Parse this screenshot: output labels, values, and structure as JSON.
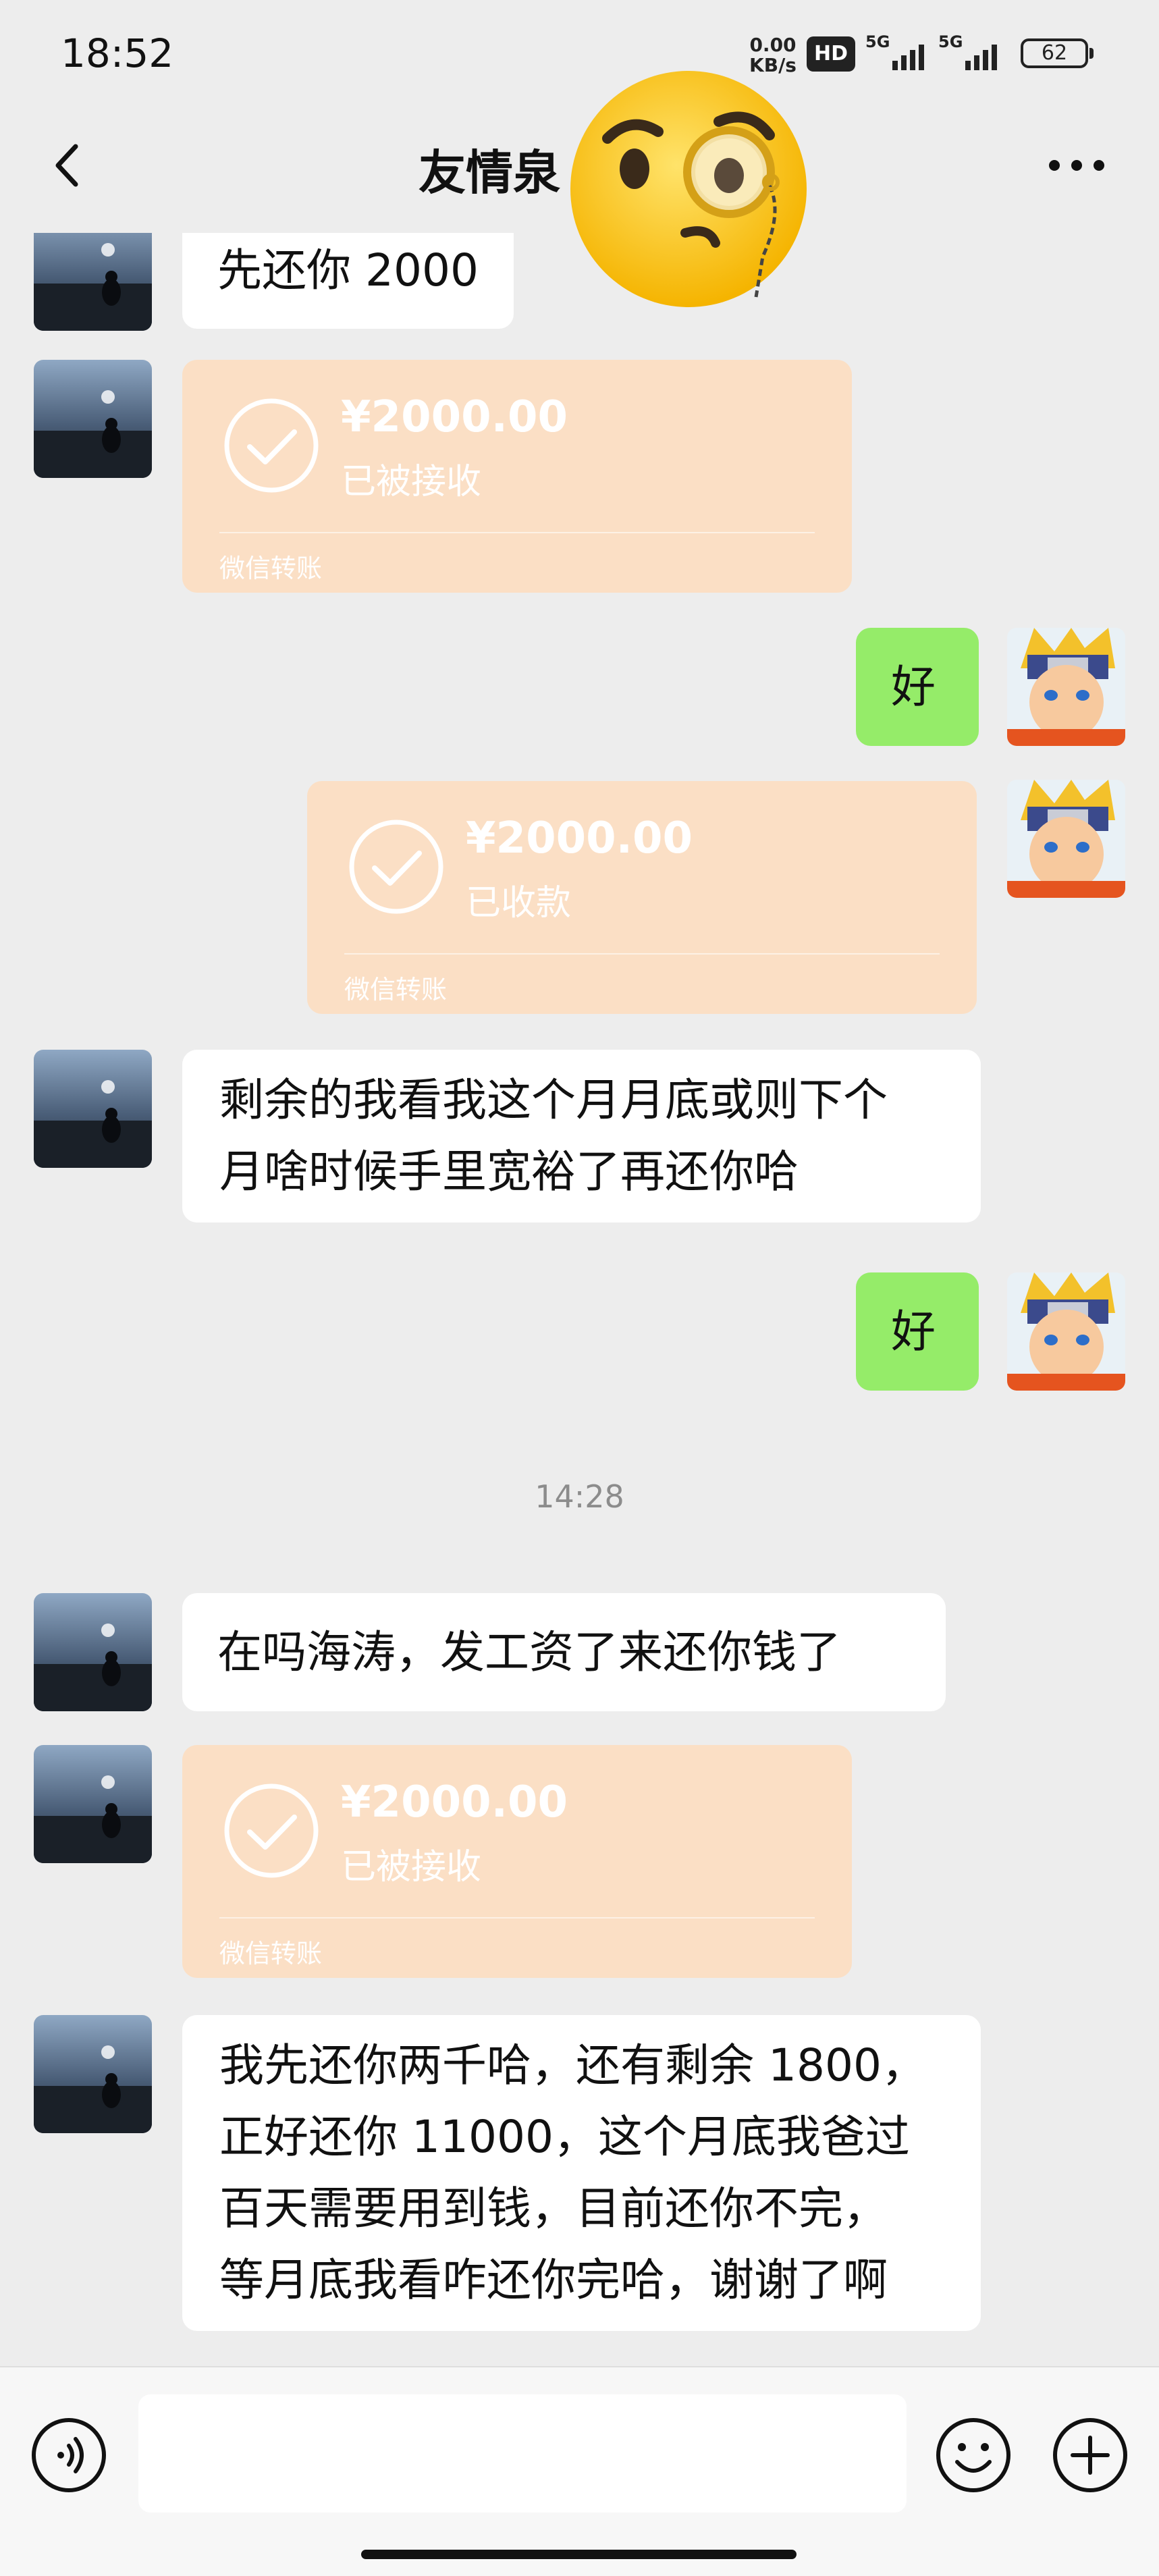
{
  "status_bar": {
    "time": "18:52",
    "net_speed_value": "0.00",
    "net_speed_unit": "KB/s",
    "hd": "HD",
    "signal_1": "5G",
    "signal_2": "5G",
    "battery": "62"
  },
  "header": {
    "title": "友情泉",
    "back_icon": "chevron-left-icon",
    "more_icon": "more-horizontal-icon",
    "sticker": "face-with-monocle-emoji"
  },
  "messages": [
    {
      "side": "left",
      "type": "text",
      "text": "先还你 2000"
    },
    {
      "side": "left",
      "type": "transfer",
      "amount": "¥2000.00",
      "status": "已被接收",
      "label": "微信转账"
    },
    {
      "side": "right",
      "type": "text",
      "text": "好"
    },
    {
      "side": "right",
      "type": "transfer",
      "amount": "¥2000.00",
      "status": "已收款",
      "label": "微信转账"
    },
    {
      "side": "left",
      "type": "text",
      "lines": [
        "剩余的我看我这个月月底或则下个",
        "月啥时候手里宽裕了再还你哈"
      ]
    },
    {
      "side": "right",
      "type": "text",
      "text": "好"
    },
    {
      "type": "time",
      "text": "14:28"
    },
    {
      "side": "left",
      "type": "text",
      "text": "在吗海涛，发工资了来还你钱了"
    },
    {
      "side": "left",
      "type": "transfer",
      "amount": "¥2000.00",
      "status": "已被接收",
      "label": "微信转账"
    },
    {
      "side": "left",
      "type": "text",
      "lines": [
        "我先还你两千哈，还有剩余 1800，",
        "正好还你 11000，这个月底我爸过",
        "百天需要用到钱，目前还你不完，",
        "等月底我看咋还你完哈，谢谢了啊"
      ]
    }
  ],
  "input_bar": {
    "voice_icon": "voice-icon",
    "emoji_icon": "emoji-icon",
    "plus_icon": "plus-icon",
    "placeholder": ""
  },
  "colors": {
    "background": "#ededed",
    "self_bubble": "#95ec69",
    "other_bubble": "#ffffff",
    "transfer_card": "#fbdfc5"
  }
}
